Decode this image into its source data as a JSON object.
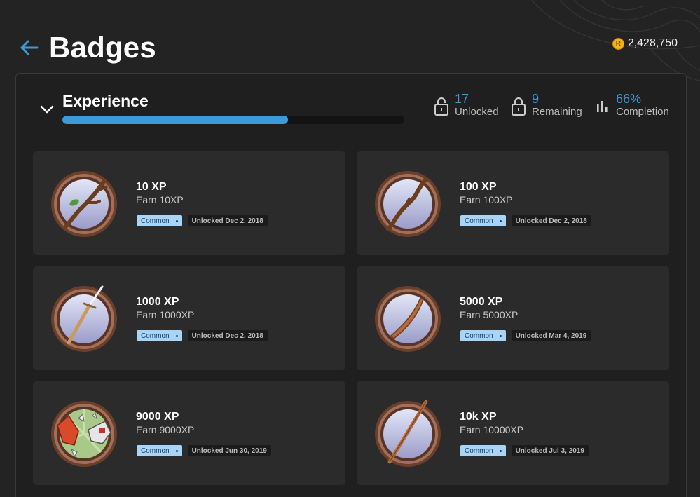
{
  "page": {
    "title": "Badges"
  },
  "currency": {
    "icon": "coin-icon",
    "amount": "2,428,750"
  },
  "section": {
    "title": "Experience",
    "progress_percent": 66,
    "stats": [
      {
        "icon": "unlocked-lock-icon",
        "value": "17",
        "label": "Unlocked"
      },
      {
        "icon": "locked-lock-icon",
        "value": "9",
        "label": "Remaining"
      },
      {
        "icon": "bar-chart-icon",
        "value": "66%",
        "label": "Completion"
      }
    ]
  },
  "badges": [
    {
      "title": "10 XP",
      "description": "Earn 10XP",
      "rarity": "Common",
      "unlocked": "Unlocked Dec 2, 2018",
      "art": "twig-with-leaf"
    },
    {
      "title": "100 XP",
      "description": "Earn 100XP",
      "rarity": "Common",
      "unlocked": "Unlocked Dec 2, 2018",
      "art": "branch"
    },
    {
      "title": "1000 XP",
      "description": "Earn 1000XP",
      "rarity": "Common",
      "unlocked": "Unlocked Dec 2, 2018",
      "art": "bamboo-sword"
    },
    {
      "title": "5000 XP",
      "description": "Earn 5000XP",
      "rarity": "Common",
      "unlocked": "Unlocked Mar 4, 2019",
      "art": "wooden-sword"
    },
    {
      "title": "9000 XP",
      "description": "Earn 9000XP",
      "rarity": "Common",
      "unlocked": "Unlocked Jun 30, 2019",
      "art": "shattered-armor"
    },
    {
      "title": "10k XP",
      "description": "Earn 10000XP",
      "rarity": "Common",
      "unlocked": "Unlocked Jul 3, 2019",
      "art": "wooden-staff"
    }
  ],
  "colors": {
    "accent": "#3d9ad8",
    "rarity_tag": "#a8d4f7",
    "card_bg": "#2b2b2b",
    "page_bg": "#232323"
  }
}
